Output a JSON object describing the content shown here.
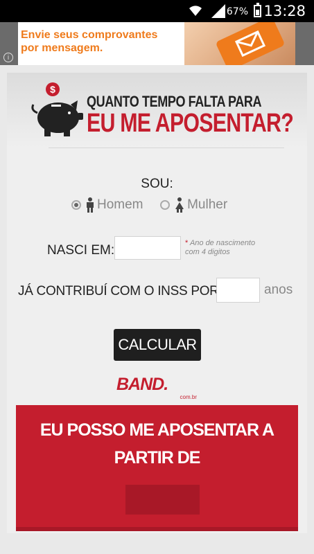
{
  "status_bar": {
    "battery_percent": "67%",
    "time": "13:28",
    "icons": [
      "wifi-icon",
      "signal-icon",
      "battery-icon"
    ]
  },
  "ad": {
    "line1": "Envie seus comprovantes",
    "line2": "por mensagem.",
    "info_label": "i"
  },
  "header": {
    "title_line1": "QUANTO TEMPO FALTA PARA",
    "title_line2": "EU ME APOSENTAR?"
  },
  "form": {
    "sou_label": "SOU:",
    "gender_options": [
      {
        "label": "Homem",
        "selected": true
      },
      {
        "label": "Mulher",
        "selected": false
      }
    ],
    "birth_label": "NASCI EM:",
    "birth_value": "",
    "birth_hint_line1": "Ano de nascimento",
    "birth_hint_line2": "com 4 digitos",
    "inss_label": "JÁ CONTRIBUÍ COM O INSS POR:",
    "inss_value": "",
    "inss_suffix": "anos",
    "calc_button": "CALCULAR"
  },
  "brand": {
    "logo": "BAND.",
    "sub": "com.br"
  },
  "result": {
    "line1": "EU POSSO ME APOSENTAR A",
    "line2": "PARTIR DE",
    "value": ""
  },
  "colors": {
    "accent_red": "#c41e2e",
    "ad_orange": "#ef7b1c",
    "button_dark": "#1f1f1f"
  }
}
